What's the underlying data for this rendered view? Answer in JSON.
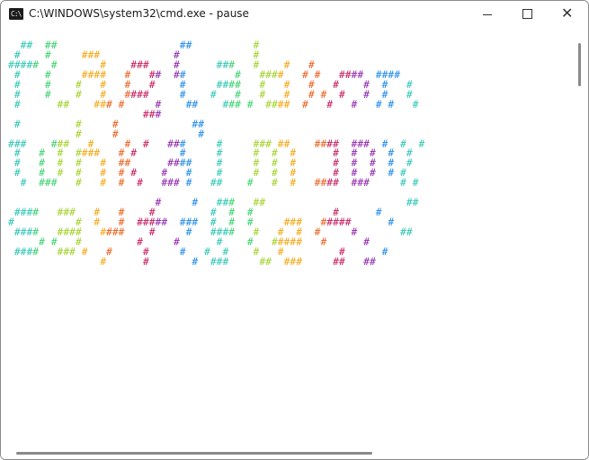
{
  "window": {
    "title": "C:\\WINDOWS\\system32\\cmd.exe - pause",
    "icon": "cmd-icon",
    "icon_glyph": "C:\\",
    "controls": {
      "minimize": "minimize-icon",
      "maximize": "maximize-icon",
      "close": "close-icon",
      "close_glyph": "✕"
    }
  },
  "console": {
    "palette": [
      "#2ec4b6",
      "#3bd16f",
      "#a3d12a",
      "#f3a712",
      "#e8601c",
      "#c2185b",
      "#8e24aa",
      "#1e88e5"
    ],
    "lines": [
      "  ##  ##                    ##          #",
      " #    #     ###            #            #",
      "#####  #       #    ###    #      ###   #    #   #",
      " #    #     ####   #   ##  ##        #   ####   # #   ####  ####",
      " #    #    #   #   #   #    #     ####   #   #   #   #    #  #   #",
      " #    #    #   #   ####     #    #   #   #   #   # #  #   #  #   #",
      " #      ##    ### #     #    ##    ### #  ####  #   #   #   # #   #",
      "                      ###",
      " #         #     #            ##",
      "           #     #             #",
      "###    ###   #     #  #   ###     #     ### ##    ####  ###  #  #  #",
      " #   #  #  ####   # #       #     #     #  #  #      #  #  #  #  #",
      " #   #  #  #   #  ##      ####    #     #  #  #      #  #  #  #  #",
      " #   #  #  #   #  # #    #   #    #     #  #  #      #  #  #  # #",
      "  #  ###   #   #  #  #   ### #   ##    #   #  #   ####  ###     # #",
      "",
      "                        #     #   ###   ##                       ##",
      " ####   ###   #   #    #         #  #  #             #      #",
      "#          #  #   #  #####  ###  #  #  #     ###   #####      #",
      " ####   ####   ####    #     #   ####   #   #  #  #     #       ##",
      "     # #   #         #     #      #    #   #####   #      #",
      " ####   ### #   #     #     #   #  #    #   #         #      #",
      "               #      #       #  ###     ##  ###     ##   ##"
    ]
  }
}
